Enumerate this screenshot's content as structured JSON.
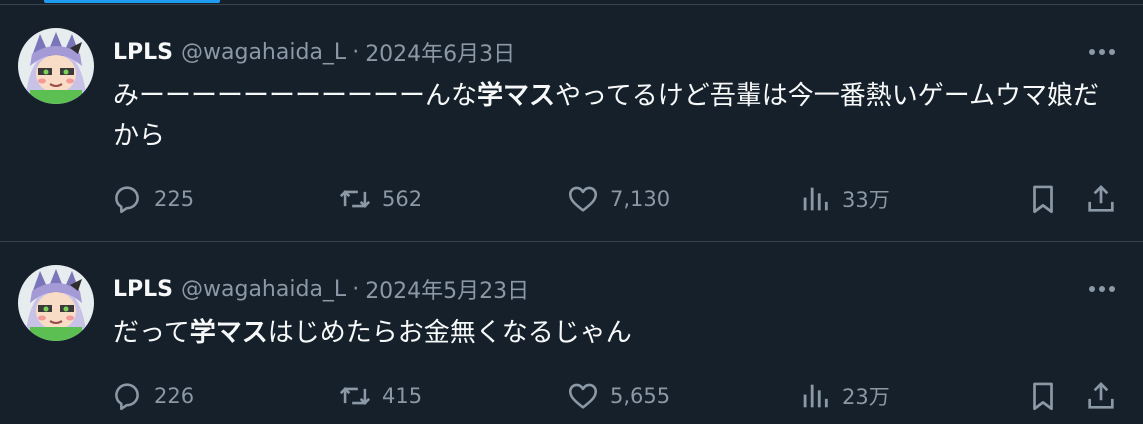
{
  "colors": {
    "background": "#15202b",
    "divider": "#38444d",
    "primary_text": "#f7f9f9",
    "secondary_text": "#8b98a5",
    "accent": "#1d9bf0"
  },
  "icons": {
    "reply": "speech-bubble-icon",
    "retweet": "retweet-arrows-icon",
    "like": "heart-icon",
    "views": "bar-chart-icon",
    "bookmark": "bookmark-icon",
    "share": "share-upload-icon",
    "more": "three-dots-icon"
  },
  "tweets": [
    {
      "display_name": "LPLS",
      "handle": "@wagahaida_L",
      "separator": "·",
      "date": "2024年6月3日",
      "text_before": "みーーーーーーーーーーーんな",
      "text_bold": "学マス",
      "text_after": "やってるけど吾輩は今一番熱いゲームウマ娘だから",
      "replies": "225",
      "retweets": "562",
      "likes": "7,130",
      "views": "33万"
    },
    {
      "display_name": "LPLS",
      "handle": "@wagahaida_L",
      "separator": "·",
      "date": "2024年5月23日",
      "text_before": "だって",
      "text_bold": "学マス",
      "text_after": "はじめたらお金無くなるじゃん",
      "replies": "226",
      "retweets": "415",
      "likes": "5,655",
      "views": "23万"
    }
  ]
}
